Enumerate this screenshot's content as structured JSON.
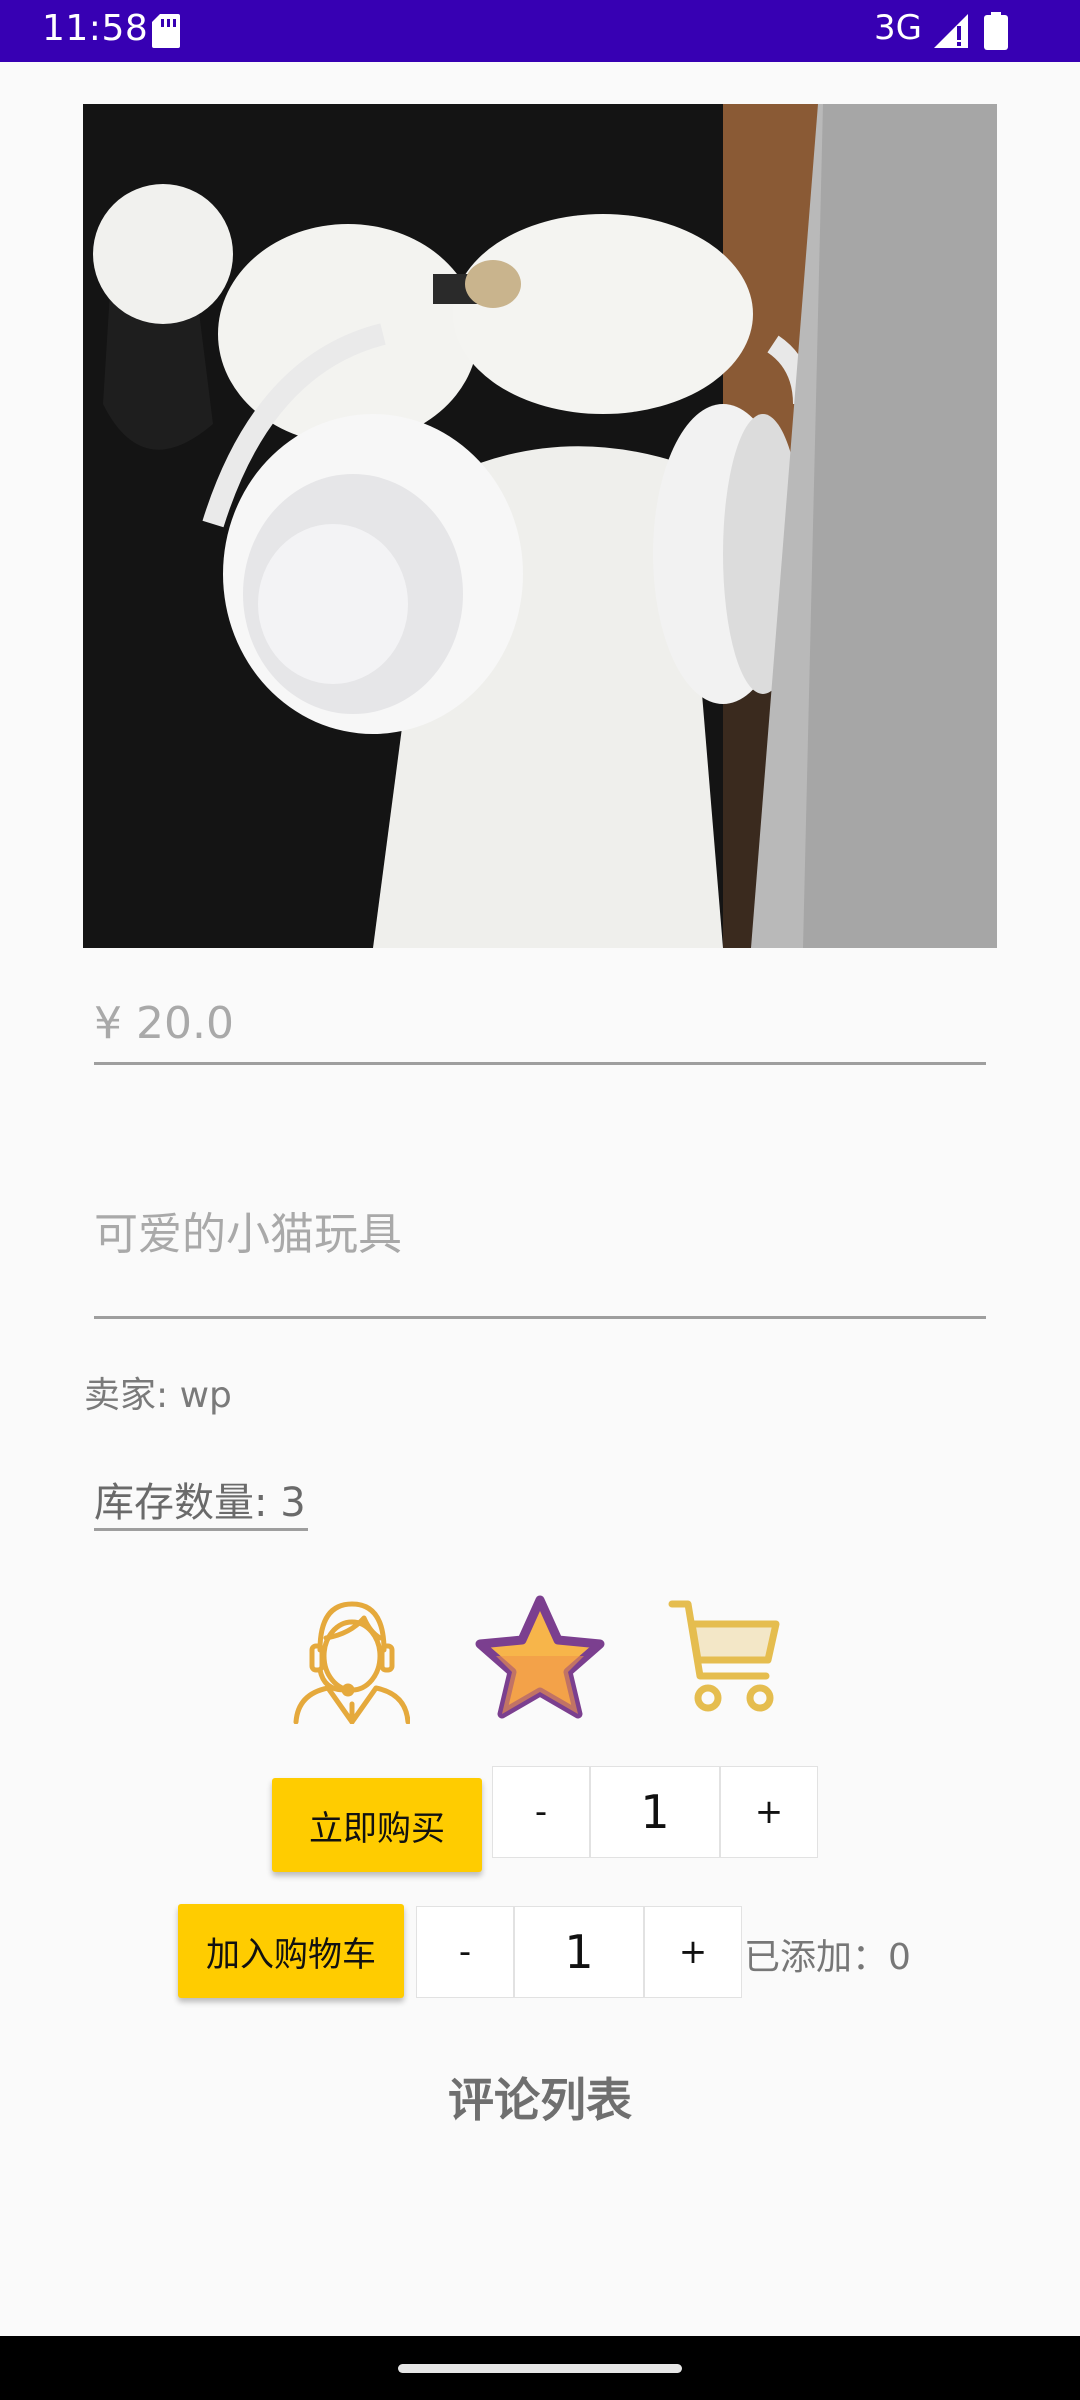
{
  "status_bar": {
    "time": "11:58",
    "network": "3G",
    "icons": [
      "sd-card-icon",
      "signal-icon",
      "battery-icon"
    ],
    "background": "#3700b3"
  },
  "product": {
    "image_alt": "cat toy with headphones photo",
    "price": "¥ 20.0",
    "title": "可爱的小猫玩具",
    "seller": "卖家: wp",
    "stock": "库存数量: 3"
  },
  "icons": {
    "service": "customer-service-icon",
    "favorite": "star-icon",
    "cart": "shopping-cart-icon"
  },
  "buy_now": {
    "label": "立即购买",
    "minus": "-",
    "quantity": "1",
    "plus": "+"
  },
  "add_to_cart": {
    "label": "加入购物车",
    "minus": "-",
    "quantity": "1",
    "plus": "+",
    "added": "已添加：0"
  },
  "comments": {
    "title": "评论列表"
  },
  "colors": {
    "accent": "#ffcc00",
    "star": "#f5a623",
    "star_outline": "#7b3f8f",
    "icon_gold": "#e5a93c"
  }
}
